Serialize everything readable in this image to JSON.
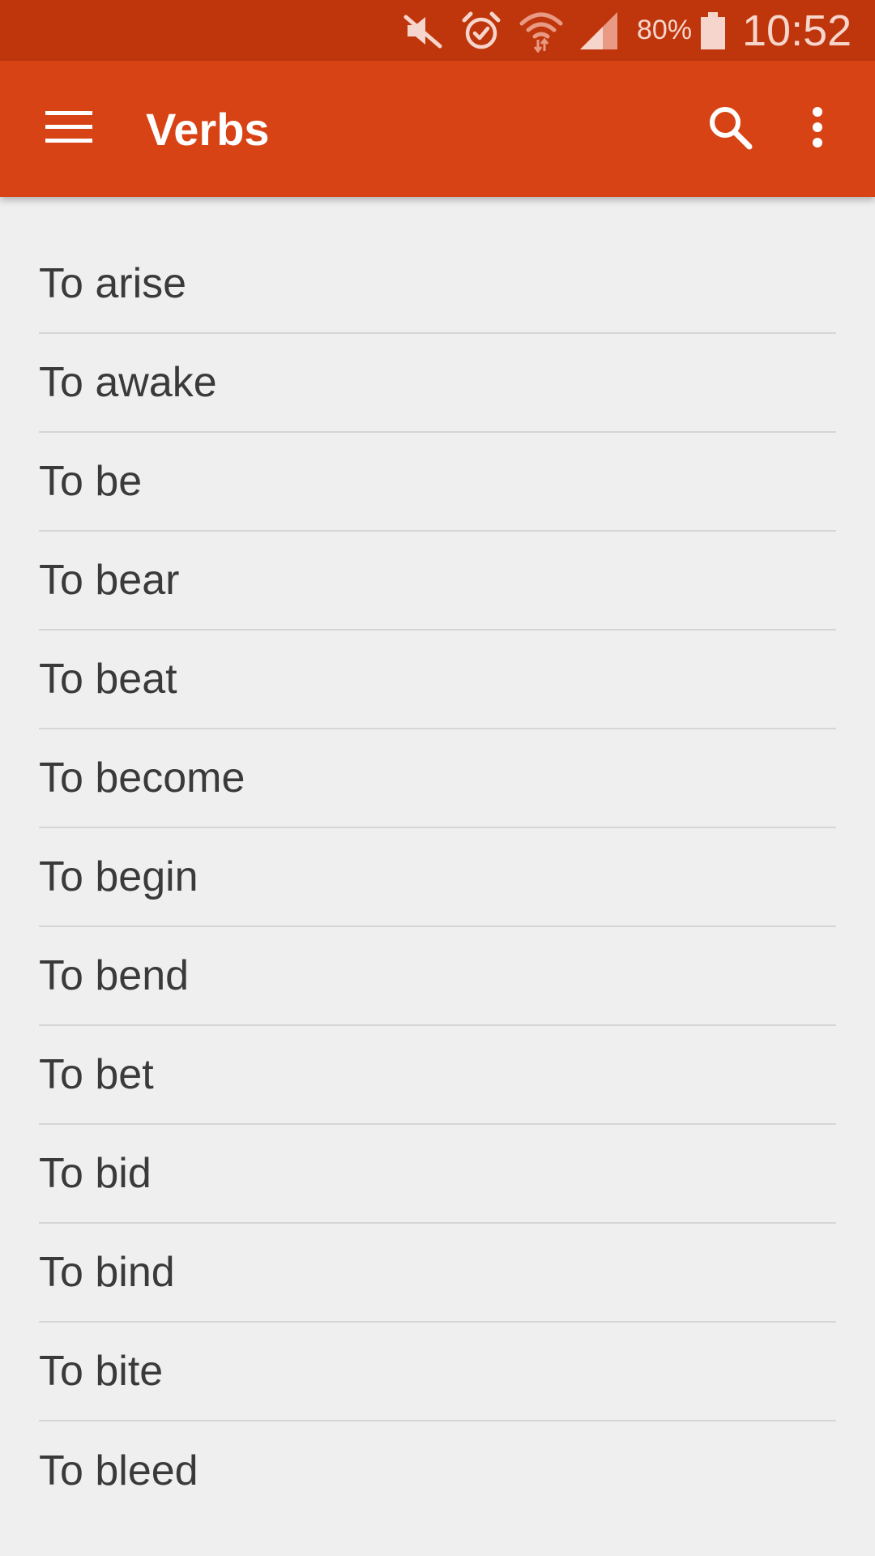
{
  "status_bar": {
    "battery_percent": "80%",
    "time": "10:52",
    "icons": [
      "mute-icon",
      "alarm-icon",
      "wifi-icon",
      "signal-icon",
      "battery-icon"
    ],
    "color": "#bf360c"
  },
  "app_bar": {
    "title": "Verbs",
    "icons": [
      "menu-icon",
      "search-icon",
      "more-vert-icon"
    ],
    "color": "#d84315"
  },
  "verbs": [
    "To arise",
    "To awake",
    "To be",
    "To bear",
    "To beat",
    "To become",
    "To begin",
    "To bend",
    "To bet",
    "To bid",
    "To bind",
    "To bite",
    "To bleed"
  ]
}
